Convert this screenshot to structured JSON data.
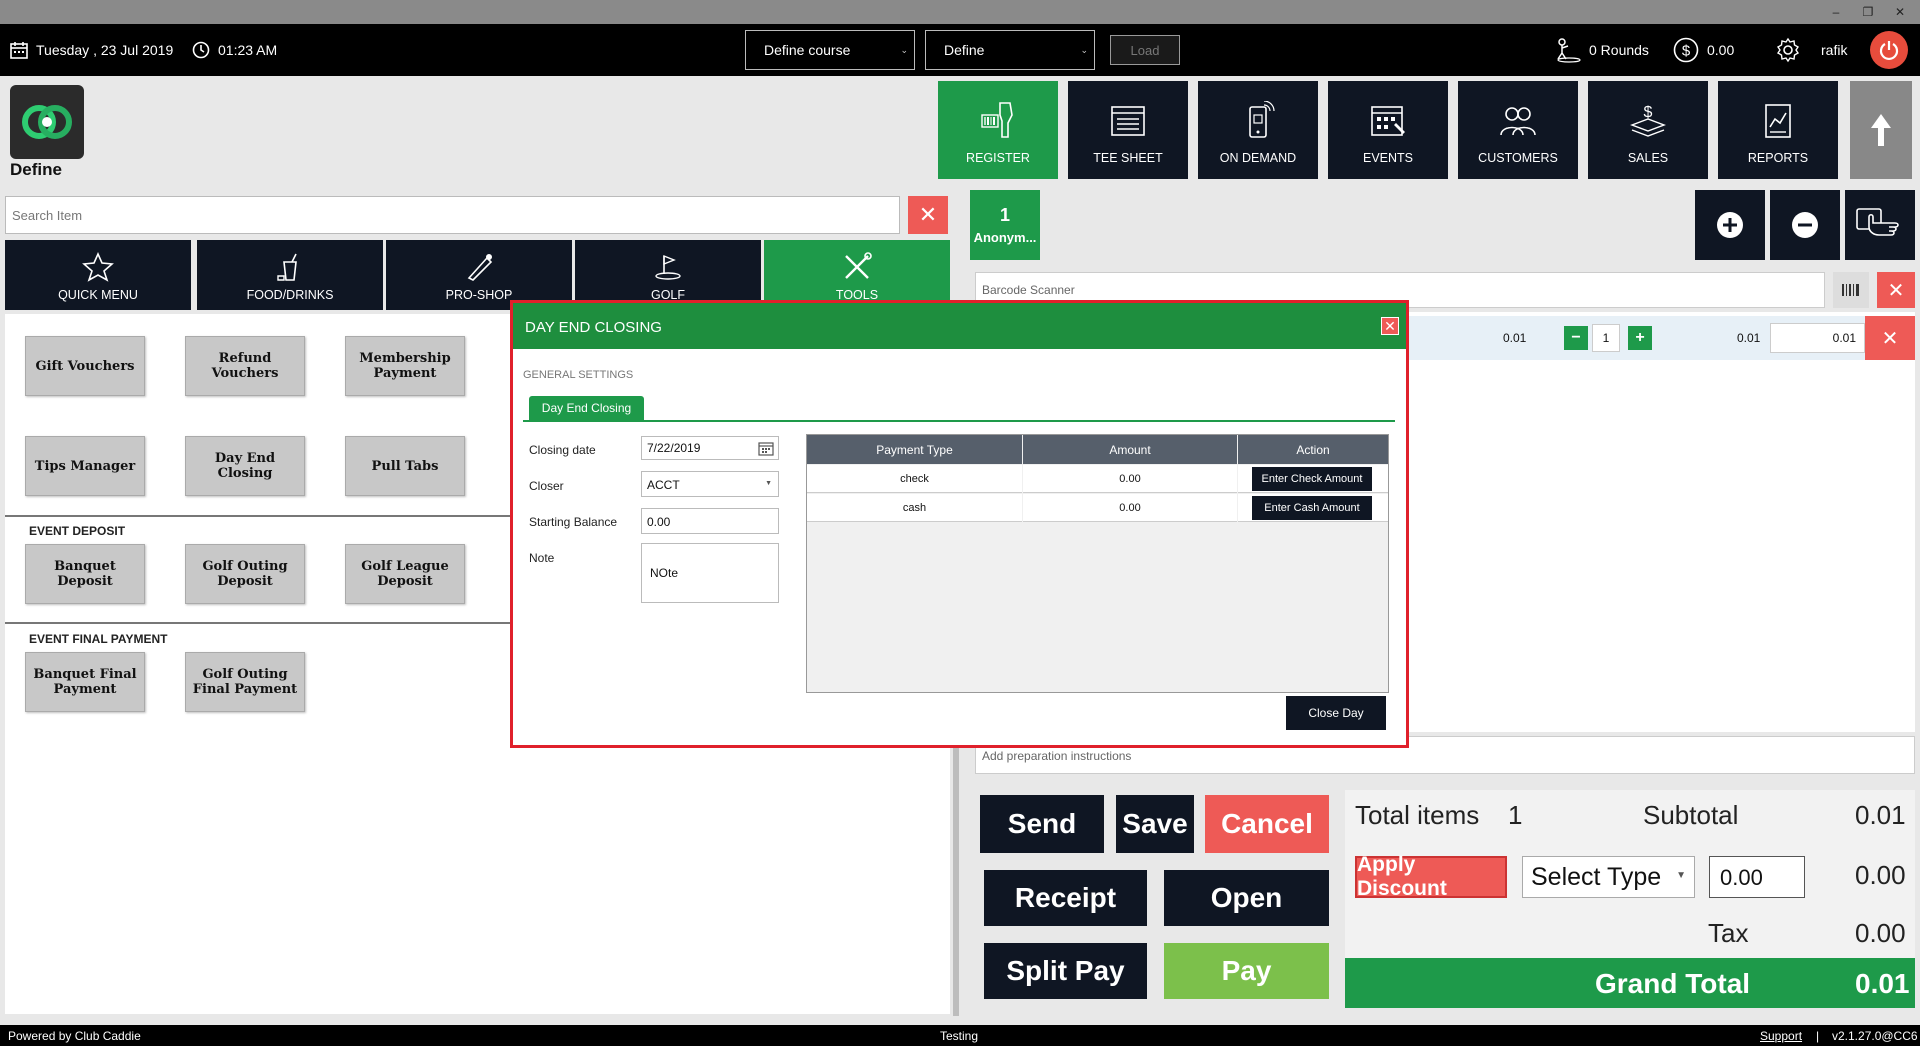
{
  "window": {
    "minimize": "–",
    "restore": "❐",
    "close": "✕"
  },
  "topbar": {
    "date": "Tuesday ,  23 Jul 2019",
    "time": "01:23 AM",
    "course_select": "Define course",
    "define_select": "Define",
    "load_label": "Load",
    "rounds": "0 Rounds",
    "cash": "0.00",
    "user": "rafik"
  },
  "brand": {
    "label": "Define"
  },
  "nav": [
    {
      "label": "REGISTER",
      "icon": "barcode-scanner-icon"
    },
    {
      "label": "TEE SHEET",
      "icon": "sheet-icon"
    },
    {
      "label": "ON DEMAND",
      "icon": "mobile-icon"
    },
    {
      "label": "EVENTS",
      "icon": "calendar-icon"
    },
    {
      "label": "CUSTOMERS",
      "icon": "people-icon"
    },
    {
      "label": "SALES",
      "icon": "money-icon"
    },
    {
      "label": "REPORTS",
      "icon": "report-icon"
    }
  ],
  "search": {
    "placeholder": "Search Item"
  },
  "categories": [
    {
      "label": "QUICK MENU",
      "icon": "star-icon"
    },
    {
      "label": "FOOD/DRINKS",
      "icon": "drink-icon"
    },
    {
      "label": "PRO-SHOP",
      "icon": "golf-club-icon"
    },
    {
      "label": "GOLF",
      "icon": "golfer-icon"
    },
    {
      "label": "TOOLS",
      "icon": "tools-icon"
    }
  ],
  "tools": {
    "row1": [
      "Gift Vouchers",
      "Refund Vouchers",
      "Membership Payment"
    ],
    "row2": [
      "Tips Manager",
      "Day End Closing",
      "Pull Tabs"
    ],
    "event_deposit_label": "EVENT DEPOSIT",
    "event_deposit": [
      "Banquet Deposit",
      "Golf Outing Deposit",
      "Golf League Deposit"
    ],
    "event_final_label": "EVENT FINAL PAYMENT",
    "event_final": [
      "Banquet Final Payment",
      "Golf Outing Final Payment"
    ]
  },
  "customer": {
    "count": "1",
    "name": "Anonym..."
  },
  "barcode": {
    "placeholder": "Barcode Scanner"
  },
  "cart_item": {
    "price": "0.01",
    "qty": "1",
    "line_total": "0.01",
    "edit_price": "0.01"
  },
  "prep": {
    "placeholder": "Add preparation instructions"
  },
  "actions": {
    "send": "Send",
    "save": "Save",
    "cancel": "Cancel",
    "receipt": "Receipt",
    "open": "Open",
    "split_pay": "Split Pay",
    "pay": "Pay"
  },
  "totals": {
    "total_items_label": "Total items",
    "total_items": "1",
    "subtotal_label": "Subtotal",
    "subtotal": "0.01",
    "apply_discount": "Apply Discount",
    "select_type": "Select Type",
    "discount_input": "0.00",
    "discount": "0.00",
    "tax_label": "Tax",
    "tax": "0.00",
    "grand_total_label": "Grand Total",
    "grand_total": "0.01"
  },
  "footer": {
    "powered": "Powered by Club Caddie",
    "env": "Testing",
    "support": "Support",
    "sep": "|",
    "version": "v2.1.27.0@CC6"
  },
  "modal": {
    "title": "DAY END CLOSING",
    "section": "GENERAL SETTINGS",
    "tab": "Day End Closing",
    "closing_date_label": "Closing date",
    "closing_date": "7/22/2019",
    "closer_label": "Closer",
    "closer": "ACCT",
    "starting_balance_label": "Starting Balance",
    "starting_balance": "0.00",
    "note_label": "Note",
    "note": "NOte",
    "columns": [
      "Payment Type",
      "Amount",
      "Action"
    ],
    "rows": [
      {
        "type": "check",
        "amount": "0.00",
        "action": "Enter Check Amount"
      },
      {
        "type": "cash",
        "amount": "0.00",
        "action": "Enter Cash Amount"
      }
    ],
    "close_day": "Close Day"
  }
}
